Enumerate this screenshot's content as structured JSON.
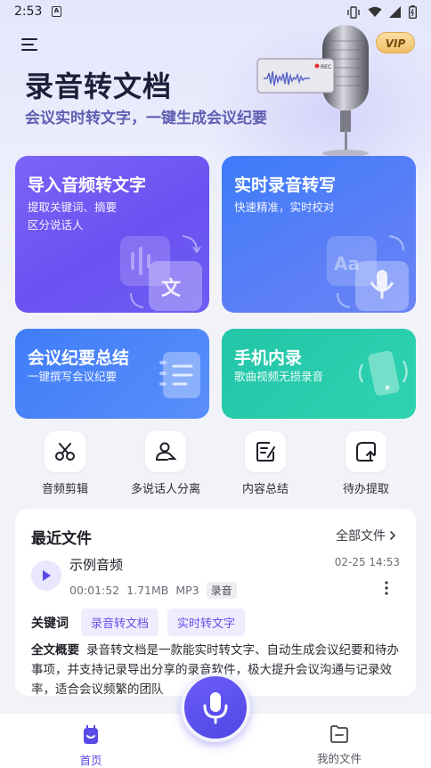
{
  "status_bar": {
    "time": "2:53"
  },
  "header": {
    "title": "录音转文档",
    "subtitle": "会议实时转文字，一键生成会议纪要",
    "vip_label": "VIP",
    "rec_label": "REC"
  },
  "cards": {
    "import": {
      "title": "导入音频转文字",
      "desc1": "提取关键词、摘要",
      "desc2": "区分说话人"
    },
    "live": {
      "title": "实时录音转写",
      "desc": "快速精准，实时校对"
    },
    "summary": {
      "title": "会议纪要总结",
      "desc": "一键撰写会议纪要"
    },
    "phone": {
      "title": "手机内录",
      "desc": "歌曲视频无损录音"
    }
  },
  "tools": [
    {
      "label": "音频剪辑",
      "icon": "scissors-icon"
    },
    {
      "label": "多说话人分离",
      "icon": "speaker-icon"
    },
    {
      "label": "内容总结",
      "icon": "note-icon"
    },
    {
      "label": "待办提取",
      "icon": "todo-icon"
    }
  ],
  "recent": {
    "title": "最近文件",
    "all_files": "全部文件",
    "file": {
      "name": "示例音频",
      "date": "02-25 14:53",
      "duration": "00:01:52",
      "size": "1.71MB",
      "format": "MP3",
      "tag": "录音"
    },
    "keywords_label": "关键词",
    "keywords": [
      "录音转文档",
      "实时转文字"
    ],
    "summary_label": "全文概要",
    "summary_text": "录音转文档是一款能实时转文字、自动生成会议纪要和待办事项，并支持记录导出分享的录音软件，极大提升会议沟通与记录效率，适合会议频繁的团队"
  },
  "bottom_nav": {
    "home": "首页",
    "files": "我的文件"
  },
  "colors": {
    "accent": "#5a4ae8",
    "card_import": "#7b63f7",
    "card_live": "#3d7cf9",
    "card_summary": "#3f7df8",
    "card_phone": "#22c6a8"
  }
}
